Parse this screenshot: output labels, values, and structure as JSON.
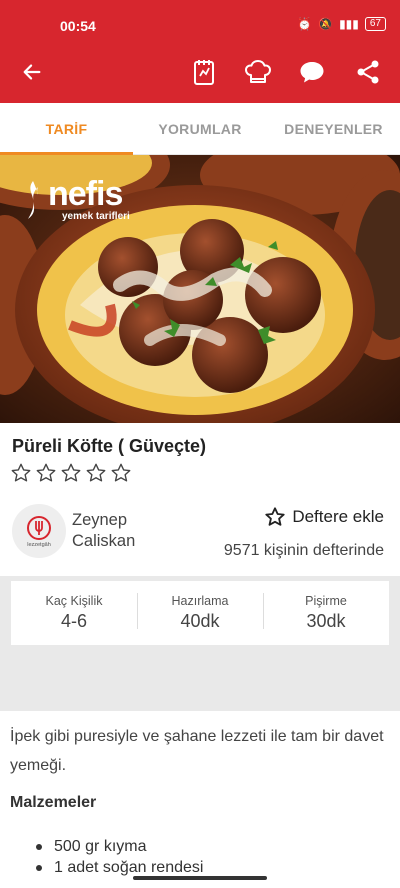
{
  "status": {
    "time": "00:54",
    "battery": "67"
  },
  "appbar": {
    "back_icon": "arrow-left-icon",
    "notebook_icon": "notebook-icon",
    "chef_icon": "chef-hat-icon",
    "comment_icon": "chat-bubble-icon",
    "share_icon": "share-icon"
  },
  "tabs": [
    {
      "label": "TARİF",
      "active": true
    },
    {
      "label": "YORUMLAR",
      "active": false
    },
    {
      "label": "DENEYENLER",
      "active": false
    }
  ],
  "hero": {
    "brand": "nefis",
    "brand_sub": "yemek tarifleri"
  },
  "recipe": {
    "title": "Püreli Köfte ( Güveçte)",
    "rating": 0,
    "rating_max": 5
  },
  "author": {
    "name": "Zeynep Caliskan",
    "avatar_label": "lezzetgâh"
  },
  "defter": {
    "label": "Deftere ekle",
    "count_text": "9571 kişinin defterinde"
  },
  "info": [
    {
      "label": "Kaç Kişilik",
      "value": "4-6"
    },
    {
      "label": "Hazırlama",
      "value": "40dk"
    },
    {
      "label": "Pişirme",
      "value": "30dk"
    }
  ],
  "description": "İpek gibi puresiyle ve şahane lezzeti ile tam bir davet yemeği.",
  "ingredients": {
    "heading": "Malzemeler",
    "items": [
      "500 gr kıyma",
      "1 adet soğan rendesi"
    ]
  },
  "colors": {
    "brand_red": "#d7262e",
    "tab_active": "#ef8a22"
  }
}
